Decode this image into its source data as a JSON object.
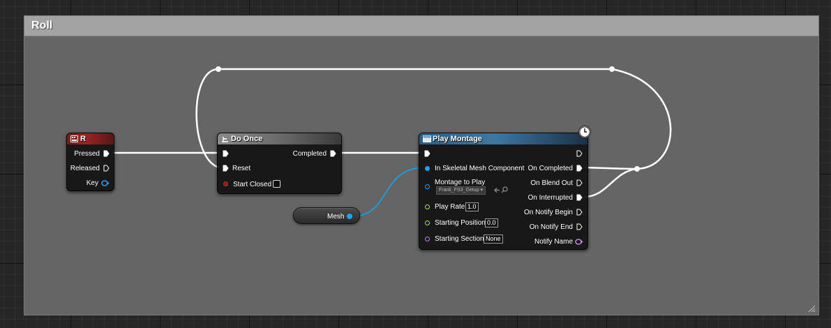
{
  "comment": {
    "title": "Roll"
  },
  "colors": {
    "wire_exec": "#ffffff",
    "wire_object": "#1f9bd8",
    "pin_object": "#1fa2ea",
    "pin_float": "#9fe34b",
    "pin_name": "#c47fe0",
    "pin_bool": "#8a1c1c"
  },
  "nodes": {
    "key_r": {
      "title": "R",
      "icon": "keyboard-icon",
      "pins": {
        "pressed": "Pressed",
        "released": "Released",
        "key": "Key"
      }
    },
    "do_once": {
      "title": "Do Once",
      "icon": "branch-icon",
      "pins": {
        "completed": "Completed",
        "reset": "Reset",
        "start_closed": "Start Closed"
      }
    },
    "mesh": {
      "label": "Mesh"
    },
    "play_montage": {
      "title": "Play Montage",
      "icon": "function-icon",
      "inputs": {
        "skeletal_mesh": "In Skeletal Mesh Component",
        "montage_to_play": "Montage to Play",
        "montage_value": "Frank_FS3_Getup",
        "play_rate": "Play Rate",
        "play_rate_value": "1.0",
        "starting_position": "Starting Position",
        "starting_position_value": "0.0",
        "starting_section": "Starting Section",
        "starting_section_value": "None"
      },
      "outputs": {
        "on_completed": "On Completed",
        "on_blend_out": "On Blend Out",
        "on_interrupted": "On Interrupted",
        "on_notify_begin": "On Notify Begin",
        "on_notify_end": "On Notify End",
        "notify_name": "Notify Name"
      }
    }
  }
}
